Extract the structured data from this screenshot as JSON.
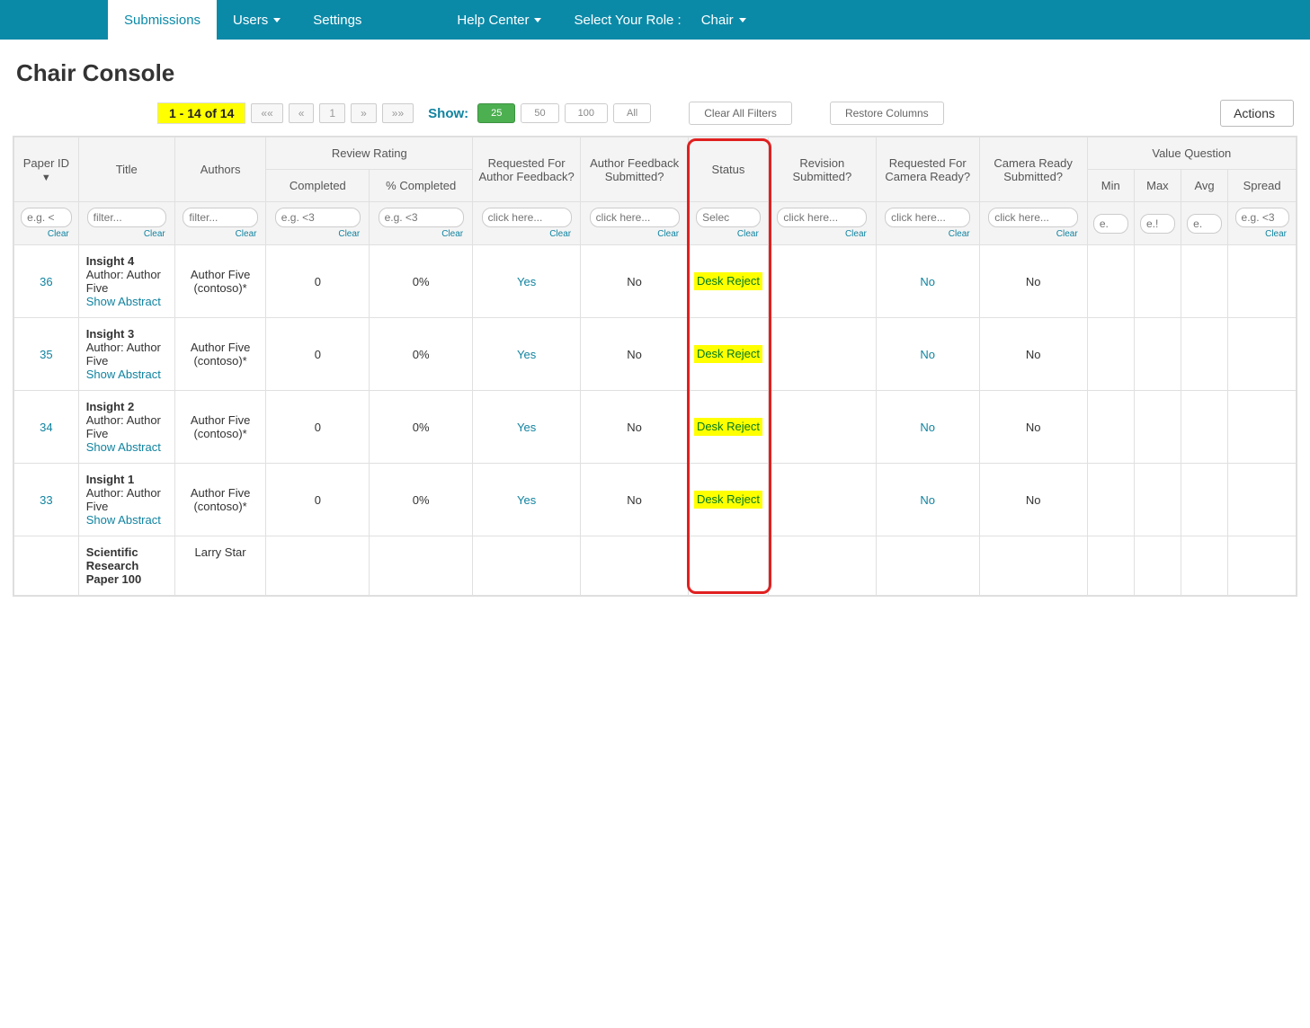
{
  "nav": {
    "submissions": "Submissions",
    "users": "Users",
    "settings": "Settings",
    "help": "Help Center",
    "role_label": "Select Your Role :",
    "role_value": "Chair"
  },
  "page_title": "Chair Console",
  "toolbar": {
    "counter": "1 - 14 of 14",
    "pager_first": "««",
    "pager_prev": "«",
    "pager_page": "1",
    "pager_next": "»",
    "pager_last": "»»",
    "show_label": "Show:",
    "size_25": "25",
    "size_50": "50",
    "size_100": "100",
    "size_all": "All",
    "clear_filters": "Clear All Filters",
    "restore_cols": "Restore Columns",
    "actions": "Actions"
  },
  "headers": {
    "paper_id": "Paper ID",
    "title": "Title",
    "authors": "Authors",
    "review_rating": "Review Rating",
    "completed": "Completed",
    "pct_completed": "% Completed",
    "req_feedback": "Requested For Author Feedback?",
    "feedback_sub": "Author Feedback Submitted?",
    "status": "Status",
    "revision_sub": "Revision Submitted?",
    "req_camera": "Requested For Camera Ready?",
    "camera_sub": "Camera Ready Submitted?",
    "value_q": "Value Question",
    "min": "Min",
    "max": "Max",
    "avg": "Avg",
    "spread": "Spread"
  },
  "filters": {
    "paper_id_ph": "e.g. <",
    "title_ph": "filter...",
    "authors_ph": "filter...",
    "completed_ph": "e.g. <3",
    "pct_ph": "e.g. <3",
    "click_ph": "click here...",
    "status_ph": "Selec",
    "min_ph": "e.",
    "max_ph": "e.!",
    "avg_ph": "e.",
    "spread_ph": "e.g. <3",
    "clear": "Clear"
  },
  "common": {
    "author_prefix": "Author:",
    "show_abs": "Show Abstract"
  },
  "rows": [
    {
      "id": "36",
      "title": "Insight 4",
      "author_line": "Author Five",
      "authors_col": "Author Five (contoso)*",
      "completed": "0",
      "pct": "0%",
      "req_fb": "Yes",
      "fb_sub": "No",
      "status": "Desk Reject",
      "rev_sub": "",
      "req_cam": "No",
      "cam_sub": "No"
    },
    {
      "id": "35",
      "title": "Insight 3",
      "author_line": "Author Five",
      "authors_col": "Author Five (contoso)*",
      "completed": "0",
      "pct": "0%",
      "req_fb": "Yes",
      "fb_sub": "No",
      "status": "Desk Reject",
      "rev_sub": "",
      "req_cam": "No",
      "cam_sub": "No"
    },
    {
      "id": "34",
      "title": "Insight 2",
      "author_line": "Author Five",
      "authors_col": "Author Five (contoso)*",
      "completed": "0",
      "pct": "0%",
      "req_fb": "Yes",
      "fb_sub": "No",
      "status": "Desk Reject",
      "rev_sub": "",
      "req_cam": "No",
      "cam_sub": "No"
    },
    {
      "id": "33",
      "title": "Insight 1",
      "author_line": "Author Five",
      "authors_col": "Author Five (contoso)*",
      "completed": "0",
      "pct": "0%",
      "req_fb": "Yes",
      "fb_sub": "No",
      "status": "Desk Reject",
      "rev_sub": "",
      "req_cam": "No",
      "cam_sub": "No"
    },
    {
      "id": "",
      "title": "Scientific Research Paper 100",
      "author_line": "",
      "authors_col": "Larry Star",
      "completed": "",
      "pct": "",
      "req_fb": "",
      "fb_sub": "",
      "status": "",
      "rev_sub": "",
      "req_cam": "",
      "cam_sub": ""
    }
  ]
}
